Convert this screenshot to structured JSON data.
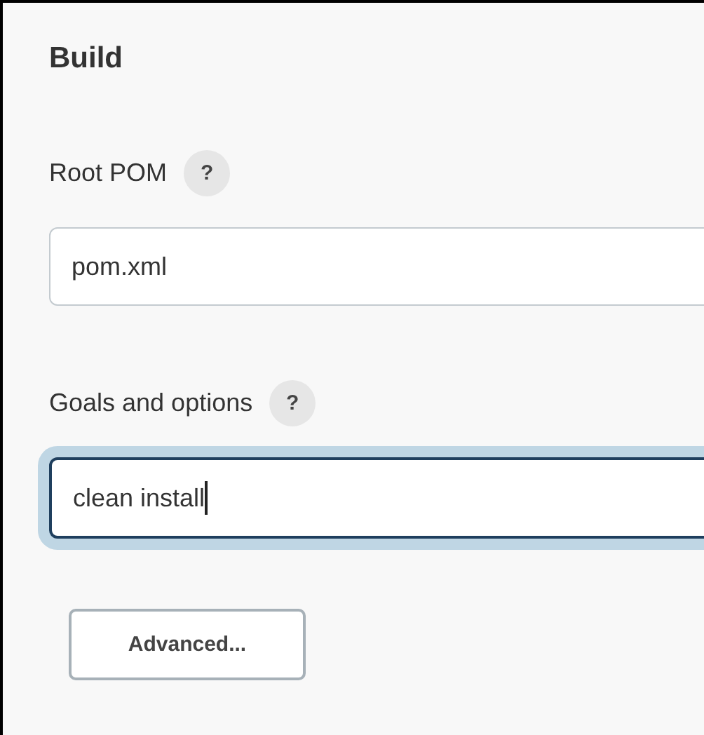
{
  "section": {
    "title": "Build"
  },
  "fields": [
    {
      "label": "Root POM",
      "help": "?",
      "value": "pom.xml",
      "focused": false
    },
    {
      "label": "Goals and options",
      "help": "?",
      "value": "clean install",
      "focused": true
    }
  ],
  "buttons": [
    {
      "label": "Advanced..."
    }
  ]
}
